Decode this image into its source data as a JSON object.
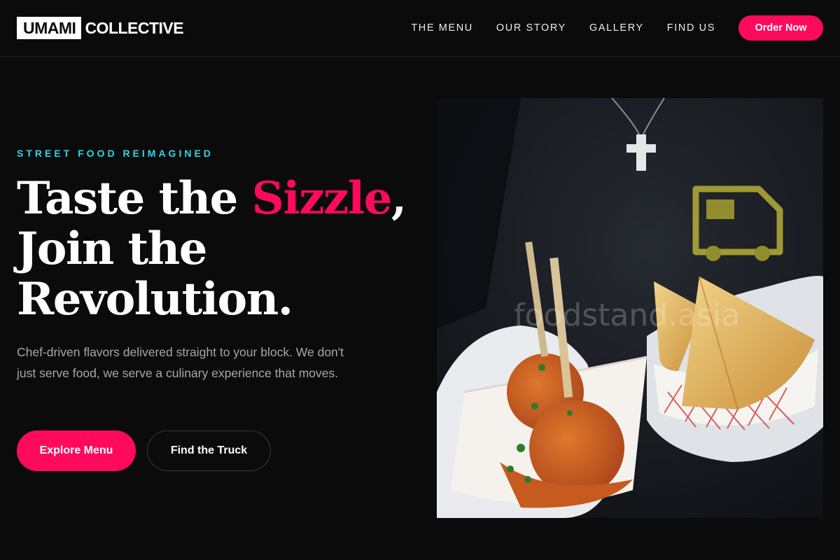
{
  "brand": {
    "box_text": "UMAMI",
    "text": "COLLECTIVE"
  },
  "nav": {
    "items": [
      {
        "label": "THE MENU"
      },
      {
        "label": "OUR STORY"
      },
      {
        "label": "GALLERY"
      },
      {
        "label": "FIND US"
      }
    ],
    "cta_label": "Order Now"
  },
  "hero": {
    "eyebrow": "STREET FOOD REIMAGINED",
    "headline_pre": "Taste the ",
    "headline_accent": "Sizzle",
    "headline_post": ", Join the Revolution.",
    "description": "Chef-driven flavors delivered straight to your block. We don't just serve food, we serve a culinary experience that moves.",
    "primary_button": "Explore Menu",
    "secondary_button": "Find the Truck"
  },
  "image": {
    "alt": "Gloved hands holding paper trays of meatballs on skewers and samosas in front of a dark shirt with a food truck print",
    "watermark": "foodstand.asia"
  },
  "colors": {
    "background": "#0b0b0c",
    "accent": "#ff0a5c",
    "eyebrow": "#2fd6e6",
    "muted_text": "#a7a7ab"
  }
}
